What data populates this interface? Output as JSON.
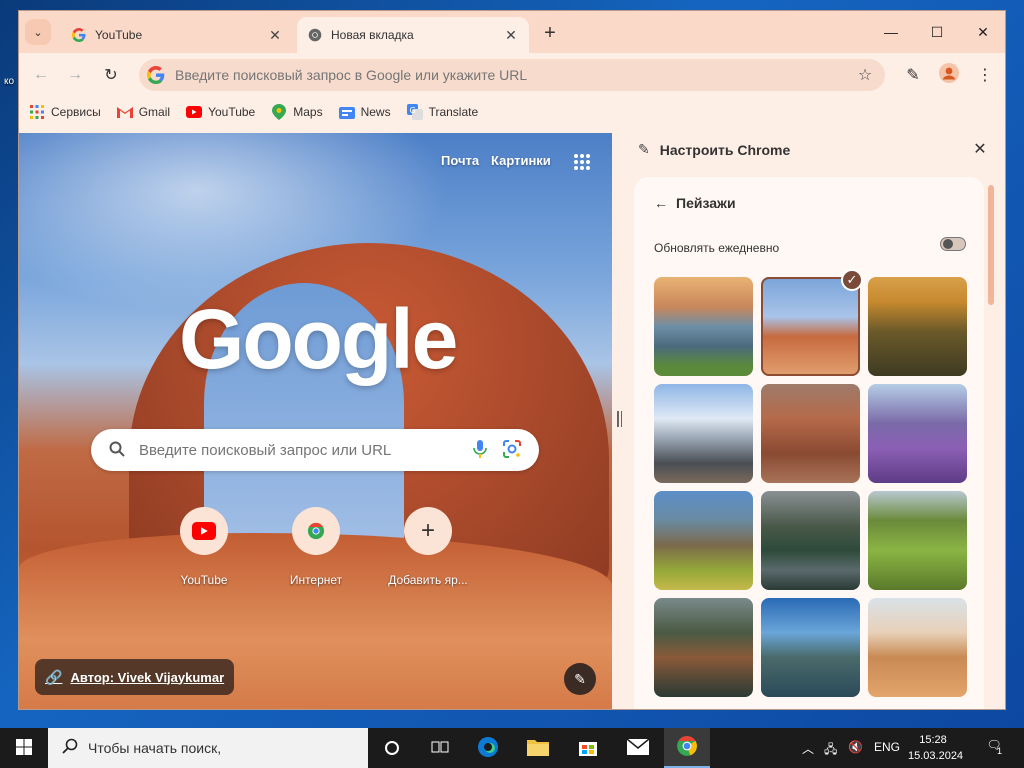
{
  "desktop": {
    "label": "ко"
  },
  "tabs": [
    {
      "title": "YouTube",
      "active": false
    },
    {
      "title": "Новая вкладка",
      "active": true
    }
  ],
  "window_controls": {
    "minimize": "—",
    "maximize": "☐",
    "close": "✕"
  },
  "omnibox": {
    "placeholder": "Введите поисковый запрос в Google или укажите URL"
  },
  "bookmarks": [
    {
      "label": "Сервисы",
      "icon": "apps-grid-icon"
    },
    {
      "label": "Gmail",
      "icon": "gmail-icon"
    },
    {
      "label": "YouTube",
      "icon": "youtube-icon"
    },
    {
      "label": "Maps",
      "icon": "maps-icon"
    },
    {
      "label": "News",
      "icon": "news-icon"
    },
    {
      "label": "Translate",
      "icon": "translate-icon"
    }
  ],
  "ntp": {
    "links": {
      "mail": "Почта",
      "images": "Картинки"
    },
    "logo": "Google",
    "search_placeholder": "Введите поисковый запрос или URL",
    "shortcuts": [
      {
        "label": "YouTube",
        "icon": "youtube-icon"
      },
      {
        "label": "Интернет",
        "icon": "chrome-icon"
      },
      {
        "label": "Добавить яр...",
        "icon": "plus-icon"
      }
    ],
    "author": "Автор: Vivek Vijaykumar"
  },
  "side_panel": {
    "title": "Настроить Chrome",
    "section": "Пейзажи",
    "daily_label": "Обновлять ежедневно",
    "daily_enabled": false,
    "selected_index": 1,
    "thumbnails_count": 12
  },
  "taskbar": {
    "search_placeholder": "Чтобы начать поиск,",
    "language": "ENG",
    "time": "15:28",
    "date": "15.03.2024",
    "notification_count": "1"
  }
}
